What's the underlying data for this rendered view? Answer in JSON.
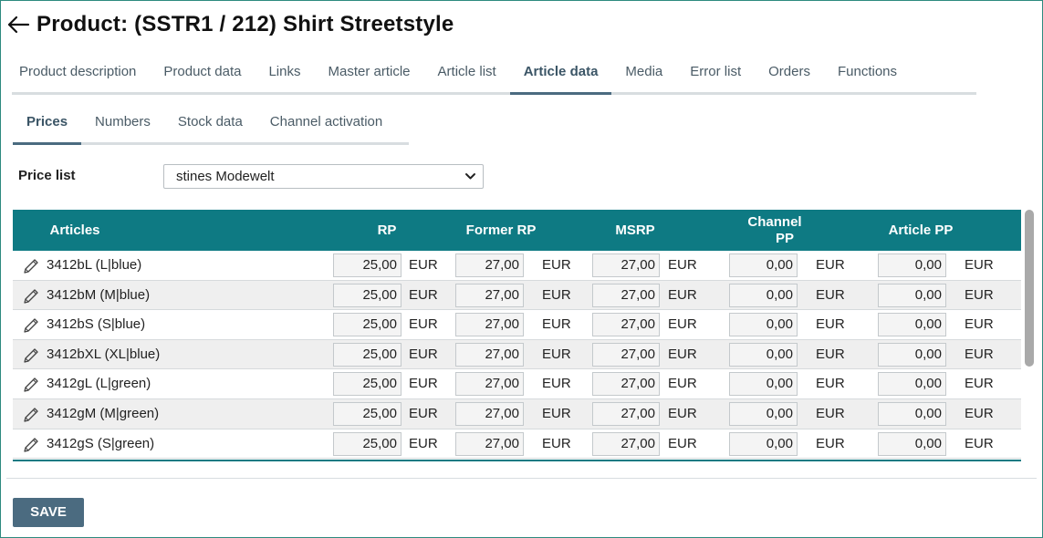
{
  "header": {
    "title": "Product: (SSTR1 / 212) Shirt Streetstyle",
    "back_icon": "arrow-left-icon"
  },
  "main_tabs": [
    {
      "label": "Product description"
    },
    {
      "label": "Product data"
    },
    {
      "label": "Links"
    },
    {
      "label": "Master article"
    },
    {
      "label": "Article list"
    },
    {
      "label": "Article data",
      "active": true
    },
    {
      "label": "Media"
    },
    {
      "label": "Error list"
    },
    {
      "label": "Orders"
    },
    {
      "label": "Functions"
    }
  ],
  "sub_tabs": [
    {
      "label": "Prices",
      "active": true
    },
    {
      "label": "Numbers"
    },
    {
      "label": "Stock data"
    },
    {
      "label": "Channel activation"
    }
  ],
  "price_list": {
    "label": "Price list",
    "selected": "stines Modewelt"
  },
  "table": {
    "headers": {
      "articles": "Articles",
      "rp": "RP",
      "former_rp": "Former RP",
      "msrp": "MSRP",
      "channel_pp_1": "Channel",
      "channel_pp_2": "PP",
      "article_pp": "Article PP"
    },
    "currency": "EUR",
    "rows": [
      {
        "article": "3412bL (L|blue)",
        "rp": "25,00",
        "former_rp": "27,00",
        "msrp": "27,00",
        "channel_pp": "0,00",
        "article_pp": "0,00"
      },
      {
        "article": "3412bM (M|blue)",
        "rp": "25,00",
        "former_rp": "27,00",
        "msrp": "27,00",
        "channel_pp": "0,00",
        "article_pp": "0,00"
      },
      {
        "article": "3412bS (S|blue)",
        "rp": "25,00",
        "former_rp": "27,00",
        "msrp": "27,00",
        "channel_pp": "0,00",
        "article_pp": "0,00"
      },
      {
        "article": "3412bXL (XL|blue)",
        "rp": "25,00",
        "former_rp": "27,00",
        "msrp": "27,00",
        "channel_pp": "0,00",
        "article_pp": "0,00"
      },
      {
        "article": "3412gL (L|green)",
        "rp": "25,00",
        "former_rp": "27,00",
        "msrp": "27,00",
        "channel_pp": "0,00",
        "article_pp": "0,00"
      },
      {
        "article": "3412gM (M|green)",
        "rp": "25,00",
        "former_rp": "27,00",
        "msrp": "27,00",
        "channel_pp": "0,00",
        "article_pp": "0,00"
      },
      {
        "article": "3412gS (S|green)",
        "rp": "25,00",
        "former_rp": "27,00",
        "msrp": "27,00",
        "channel_pp": "0,00",
        "article_pp": "0,00"
      }
    ]
  },
  "footer": {
    "save_label": "SAVE"
  },
  "colors": {
    "accent": "#0e7a83",
    "button": "#4b6b80",
    "tab_active": "#3b5566"
  }
}
